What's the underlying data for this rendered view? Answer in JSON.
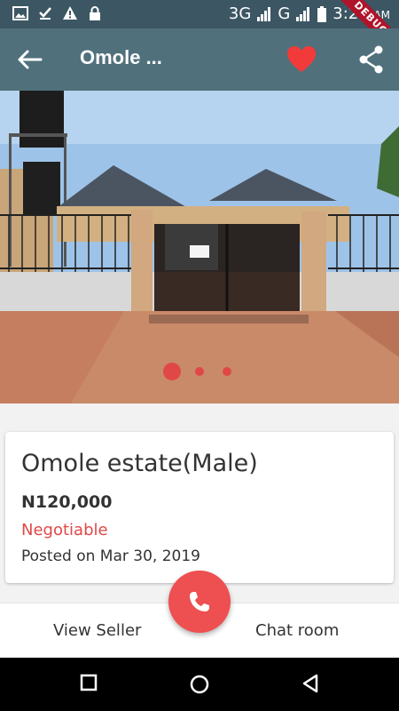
{
  "status_bar": {
    "network_3g": "3G",
    "network_g": "G",
    "time": "3:27",
    "ampm": "AM",
    "debug": "DEBUG"
  },
  "app_bar": {
    "title": "Omole ..."
  },
  "gallery": {
    "slide_count": 3,
    "active_index": 0
  },
  "listing": {
    "name": "Omole estate(Male)",
    "price": "N120,000",
    "negotiable": "Negotiable",
    "posted": "Posted on Mar 30, 2019"
  },
  "actions": {
    "view_seller": "View Seller",
    "chat_room": "Chat room"
  },
  "colors": {
    "status_bar": "#3c5663",
    "app_bar": "#50707c",
    "accent": "#ee4f50",
    "heart": "#f23a3a"
  }
}
